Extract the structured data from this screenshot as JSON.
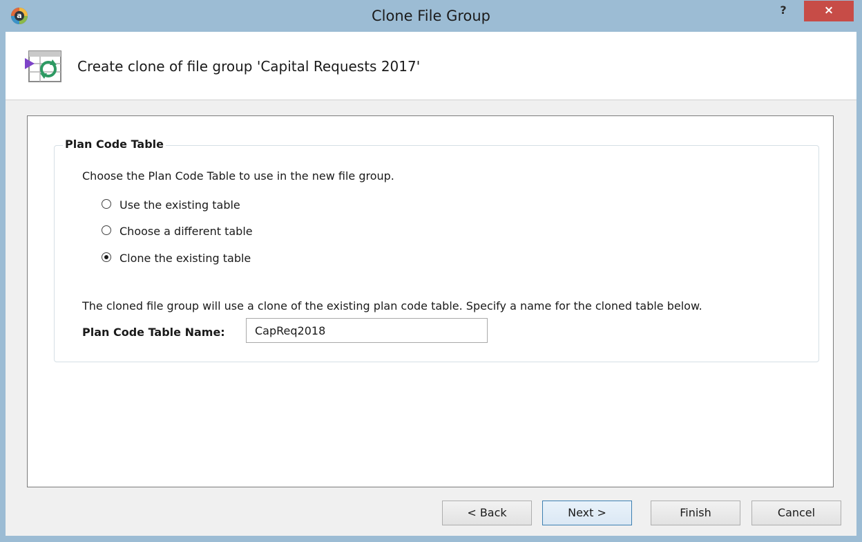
{
  "window": {
    "title": "Clone File Group",
    "help_label": "?",
    "close_label": "×"
  },
  "header": {
    "text": "Create clone of file group 'Capital Requests 2017'"
  },
  "group": {
    "title": "Plan Code Table",
    "prompt": "Choose the Plan Code Table to use in the new file group.",
    "options": [
      {
        "label": "Use the existing table",
        "checked": false
      },
      {
        "label": "Choose a different table",
        "checked": false
      },
      {
        "label": "Clone the existing table",
        "checked": true
      }
    ],
    "description": "The cloned file group will use a clone of the existing plan code table. Specify a name for the cloned table below.",
    "field_label": "Plan Code Table Name:",
    "field_value": "CapReq2018"
  },
  "buttons": {
    "back": "< Back",
    "next": "Next >",
    "finish": "Finish",
    "cancel": "Cancel"
  },
  "icons": {
    "app": "app-logo-icon",
    "wizard": "clone-table-icon"
  }
}
